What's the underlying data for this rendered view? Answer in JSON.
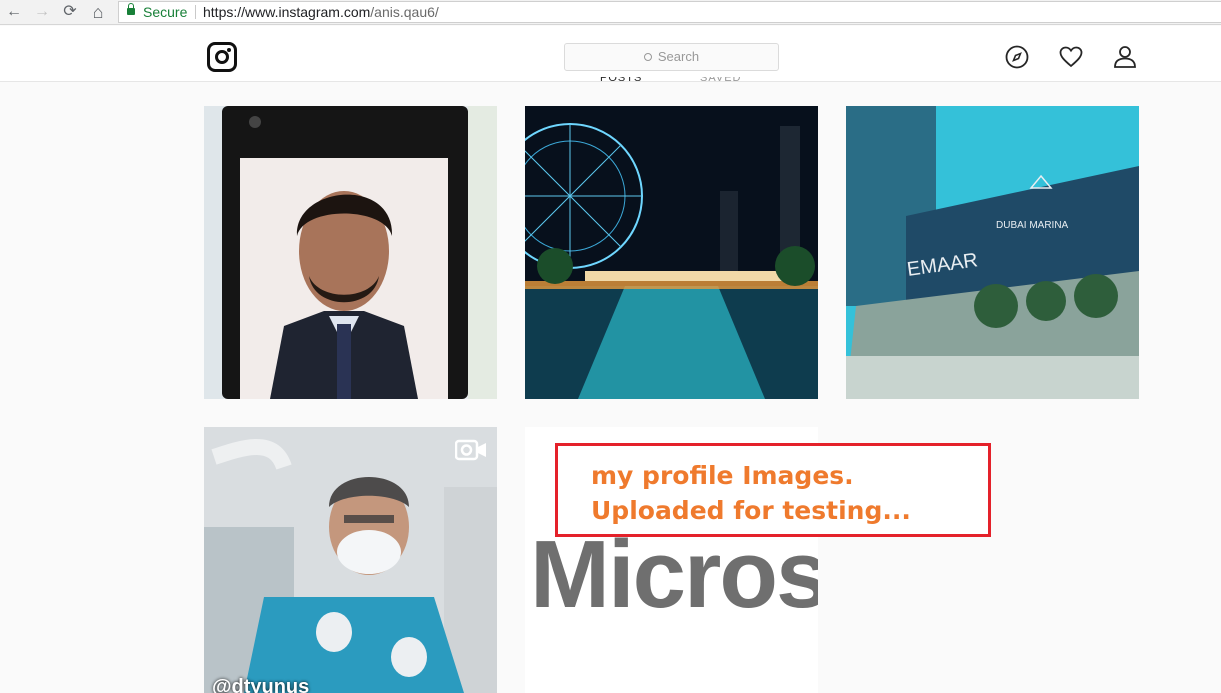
{
  "browser": {
    "nav": {
      "back": "←",
      "forward": "→",
      "reload": "⟳",
      "home": "⌂"
    },
    "security_label": "Secure",
    "url_scheme_host": "https://www.instagram.com",
    "url_path": "/anis.qau6/"
  },
  "header": {
    "search_placeholder": "Search",
    "icons": [
      "instagram-logo",
      "explore-compass-icon",
      "heart-icon",
      "profile-person-icon"
    ]
  },
  "tabs": {
    "posts": "POSTS",
    "saved": "SAVED"
  },
  "grid": {
    "tiles": [
      {
        "subject": "portrait photo on phone screen"
      },
      {
        "subject": "ferris wheel and canal at night"
      },
      {
        "subject": "Dubai Marina Emaar building"
      },
      {
        "subject": "dentist video"
      },
      {
        "subject": "Microsoft logo"
      }
    ],
    "tile3_sign_text": "EMAAR",
    "tile3_sign2": "DUBAI MARINA",
    "tile5_text": "Micros",
    "tile4_handle": "@dtyunus"
  },
  "annotation": {
    "line1": "my profile Images.",
    "line2": "Uploaded for testing...",
    "border_color": "#e4212a",
    "text_color": "#ef7a2d"
  }
}
